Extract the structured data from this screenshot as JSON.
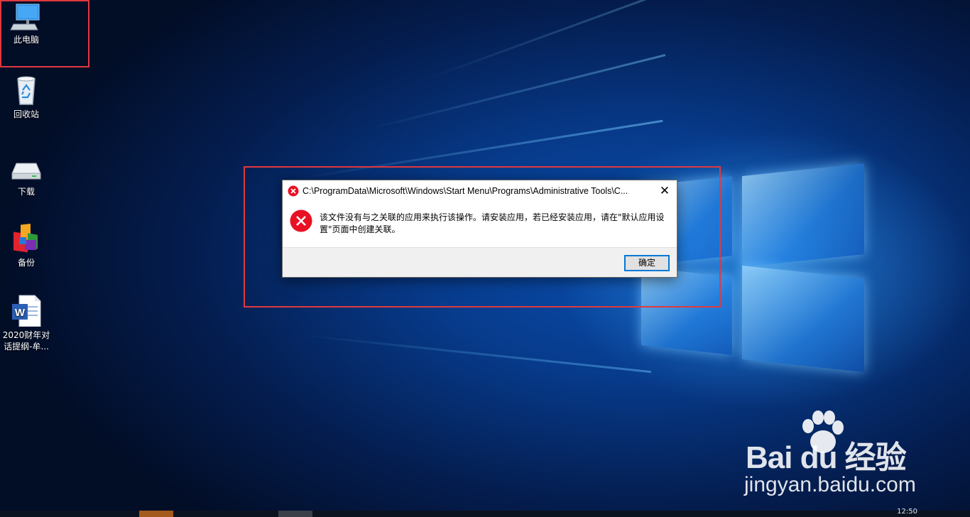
{
  "desktop": {
    "icons": [
      {
        "label": "此电脑",
        "icon": "this-pc-icon"
      },
      {
        "label": "回收站",
        "icon": "recycle-bin-icon"
      },
      {
        "label": "下载",
        "icon": "drive-icon"
      },
      {
        "label": "备份",
        "icon": "backup-app-icon"
      },
      {
        "label": "2020财年对话提纲-牟...",
        "icon": "word-document-icon"
      }
    ]
  },
  "dialog": {
    "title": "C:\\ProgramData\\Microsoft\\Windows\\Start Menu\\Programs\\Administrative Tools\\C...",
    "close_label": "✕",
    "message": "该文件没有与之关联的应用来执行该操作。请安装应用，若已经安装应用，请在\"默认应用设置\"页面中创建关联。",
    "ok_label": "确定",
    "icon": "error-icon"
  },
  "watermark": {
    "brand": "Bai  du 经验",
    "url": "jingyan.baidu.com"
  },
  "taskbar": {
    "clock": "12:50"
  },
  "colors": {
    "highlight": "#e0393e",
    "error_red": "#e81123",
    "button_border": "#0078d7",
    "desktop_blue": "#0a4fb0"
  }
}
